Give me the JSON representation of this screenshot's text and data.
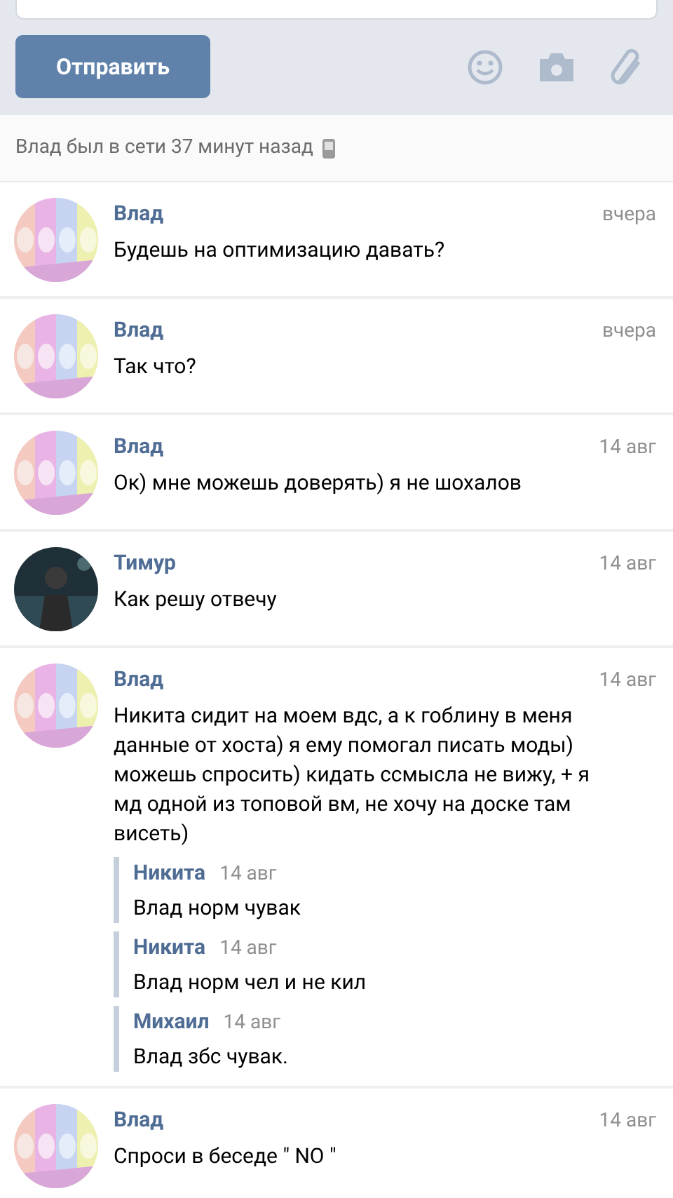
{
  "composer": {
    "send_button": "Отправить"
  },
  "status": {
    "text": "Влад был в сети 37 минут назад",
    "mobile": true
  },
  "messages": [
    {
      "author": "Влад",
      "time": "вчера",
      "text": "Будешь на оптимизацию давать?"
    },
    {
      "author": "Влад",
      "time": "вчера",
      "text": "Так что?"
    },
    {
      "author": "Влад",
      "time": "14 авг",
      "text": "Ок) мне можешь доверять) я не шохалов"
    },
    {
      "author": "Тимур",
      "time": "14 авг",
      "text": "Как решу отвечу"
    },
    {
      "author": "Влад",
      "time": "14 авг",
      "text": "Никита сидит на моем вдс, а к гоблину в меня данные от хоста) я ему помогал писать моды) можешь спросить) кидать ссмысла не вижу, + я мд одной из топовой вм, не хочу на доске там висеть)",
      "forwarded": [
        {
          "author": "Никита",
          "time": "14 авг",
          "text": "Влад норм чувак"
        },
        {
          "author": "Никита",
          "time": "14 авг",
          "text": "Влад норм чел и не кил"
        },
        {
          "author": "Михаил",
          "time": "14 авг",
          "text": "Влад збс чувак."
        }
      ]
    },
    {
      "author": "Влад",
      "time": "14 авг",
      "text": "Спроси в беседе \" NO \""
    }
  ]
}
